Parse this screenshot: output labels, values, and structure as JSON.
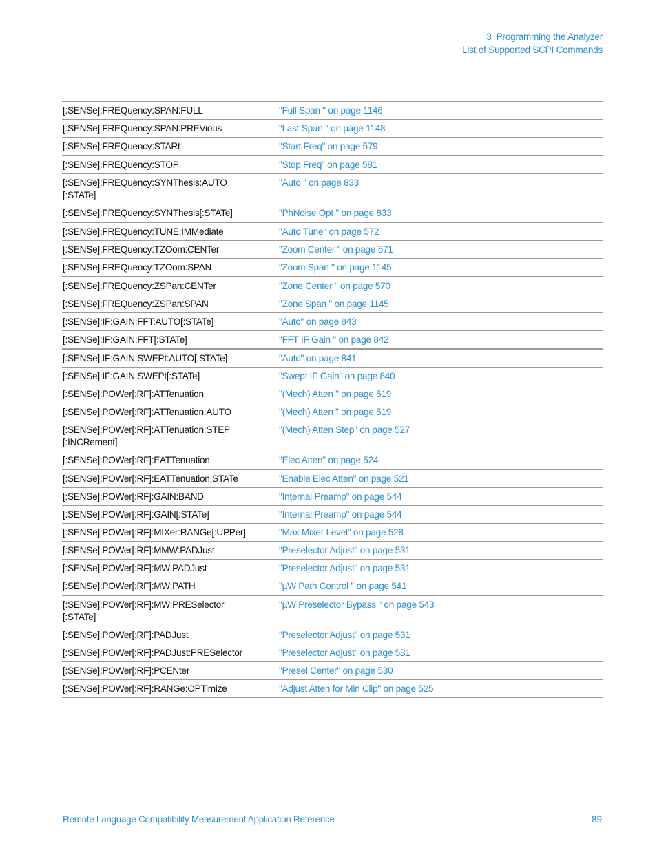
{
  "header": {
    "chapter": "3  Programming the Analyzer",
    "section": "List of Supported SCPI Commands"
  },
  "table": {
    "rows": [
      {
        "cmd": "[:SENSe]:FREQuency:SPAN:FULL",
        "ref": "\"Full Span \" on page 1146"
      },
      {
        "cmd": "[:SENSe]:FREQuency:SPAN:PREVious",
        "ref": "\"Last Span \" on page 1148"
      },
      {
        "cmd": "[:SENSe]:FREQuency:STARt",
        "ref": "\"Start Freq\" on page 579"
      },
      {
        "cmd": "[:SENSe]:FREQuency:STOP",
        "ref": "\"Stop Freq\" on page 581"
      },
      {
        "cmd": "[:SENSe]:FREQuency:SYNThesis:AUTO\n[:STATe]",
        "ref": "\"Auto \" on page 833"
      },
      {
        "cmd": "[:SENSe]:FREQuency:SYNThesis[:STATe]",
        "ref": "\"PhNoise Opt \" on page 833"
      },
      {
        "cmd": "[:SENSe]:FREQuency:TUNE:IMMediate",
        "ref": "\"Auto Tune\" on page 572"
      },
      {
        "cmd": "[:SENSe]:FREQuency:TZOom:CENTer",
        "ref": "\"Zoom Center \" on page 571"
      },
      {
        "cmd": "[:SENSe]:FREQuency:TZOom:SPAN",
        "ref": "\"Zoom Span \" on page 1145"
      },
      {
        "cmd": "[:SENSe]:FREQuency:ZSPan:CENTer",
        "ref": "\"Zone Center \" on page 570"
      },
      {
        "cmd": "[:SENSe]:FREQuency:ZSPan:SPAN",
        "ref": "\"Zone Span \" on page 1145"
      },
      {
        "cmd": "[:SENSe]:IF:GAIN:FFT:AUTO[:STATe]",
        "ref": "\"Auto\" on page 843"
      },
      {
        "cmd": "[:SENSe]:IF:GAIN:FFT[:STATe]",
        "ref": "\"FFT IF Gain \" on page 842"
      },
      {
        "cmd": "[:SENSe]:IF:GAIN:SWEPt:AUTO[:STATe]",
        "ref": "\"Auto\" on page 841"
      },
      {
        "cmd": "[:SENSe]:IF:GAIN:SWEPt[:STATe]",
        "ref": "\"Swept IF Gain\" on page 840"
      },
      {
        "cmd": "[:SENSe]:POWer[:RF]:ATTenuation",
        "ref": "\"(Mech) Atten \" on page 519"
      },
      {
        "cmd": "[:SENSe]:POWer[:RF]:ATTenuation:AUTO",
        "ref": "\"(Mech) Atten \" on page 519"
      },
      {
        "cmd": "[:SENSe]:POWer[:RF]:ATTenuation:STEP\n[:INCRement]",
        "ref": "\"(Mech) Atten Step\" on page 527"
      },
      {
        "cmd": "[:SENSe]:POWer[:RF]:EATTenuation",
        "ref": "\"Elec Atten\" on page 524"
      },
      {
        "cmd": "[:SENSe]:POWer[:RF]:EATTenuation:STATe",
        "ref": "\"Enable Elec Atten\" on page 521"
      },
      {
        "cmd": "[:SENSe]:POWer[:RF]:GAIN:BAND",
        "ref": "\"Internal Preamp\" on page 544"
      },
      {
        "cmd": "[:SENSe]:POWer[:RF]:GAIN[:STATe]",
        "ref": "\"Internal Preamp\" on page 544"
      },
      {
        "cmd": "[:SENSe]:POWer[:RF]:MIXer:RANGe[:UPPer]",
        "ref": "\"Max Mixer Level\" on page 528"
      },
      {
        "cmd": "[:SENSe]:POWer[:RF]:MMW:PADJust",
        "ref": "\"Preselector Adjust\" on page 531"
      },
      {
        "cmd": "[:SENSe]:POWer[:RF]:MW:PADJust",
        "ref": "\"Preselector Adjust\" on page 531"
      },
      {
        "cmd": "[:SENSe]:POWer[:RF]:MW:PATH",
        "ref": "\"µW Path Control \" on page 541"
      },
      {
        "cmd": "[:SENSe]:POWer[:RF]:MW:PRESelector\n[:STATe]",
        "ref": "\"µW Preselector Bypass \" on page 543"
      },
      {
        "cmd": "[:SENSe]:POWer[:RF]:PADJust",
        "ref": "\"Preselector Adjust\" on page 531"
      },
      {
        "cmd": "[:SENSe]:POWer[:RF]:PADJust:PRESelector",
        "ref": "\"Preselector Adjust\" on page 531"
      },
      {
        "cmd": "[:SENSe]:POWer[:RF]:PCENter",
        "ref": "\"Presel Center\" on page 530"
      },
      {
        "cmd": "[:SENSe]:POWer[:RF]:RANGe:OPTimize",
        "ref": "\"Adjust Atten for Min Clip\" on page 525"
      }
    ]
  },
  "footer": {
    "title": "Remote Language Compatibility Measurement Application Reference",
    "page_number": "89"
  },
  "colors": {
    "link": "#2a8fd6",
    "text": "#111111",
    "rule": "#9a9a9a"
  }
}
